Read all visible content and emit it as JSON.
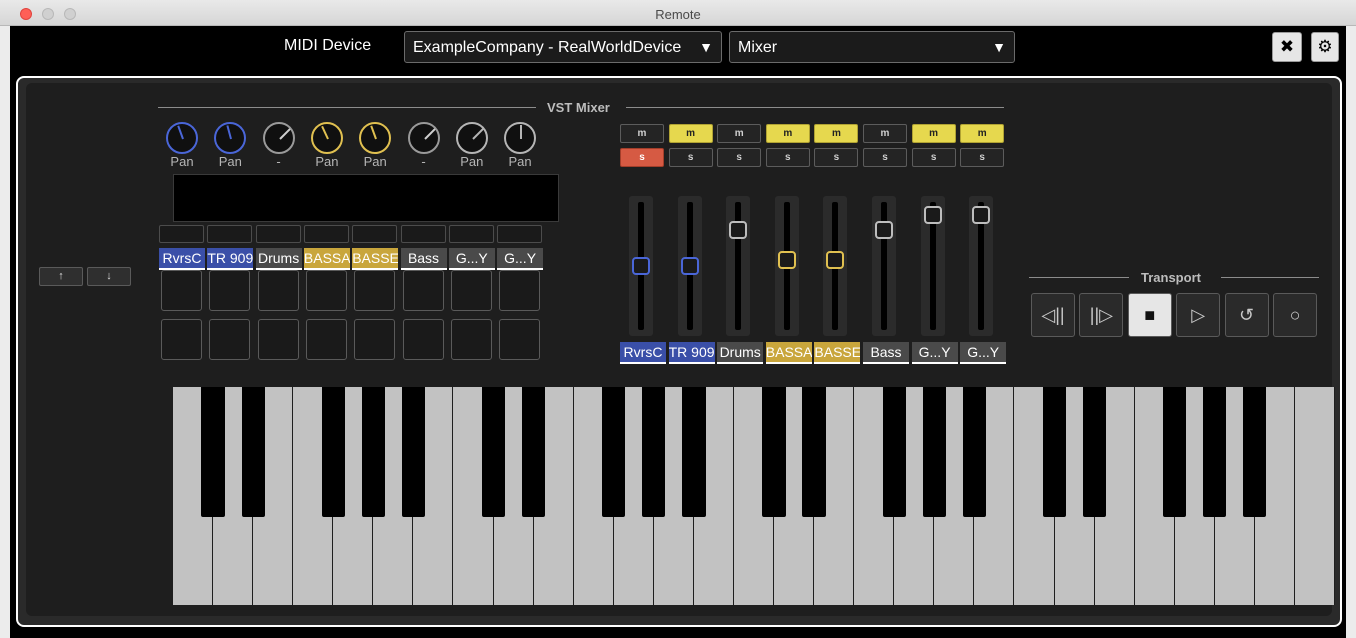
{
  "window": {
    "title": "Remote"
  },
  "topbar": {
    "midi_label": "MIDI Device",
    "device_value": "ExampleCompany - RealWorldDevice",
    "mode_value": "Mixer",
    "dropdown_arrow": "▼",
    "tools_icon": "✖",
    "settings_icon": "⚙"
  },
  "nav": {
    "up": "↑",
    "down": "↓"
  },
  "vst_mixer": {
    "title": "VST Mixer",
    "knobs": [
      {
        "label": "Pan",
        "color": "#4a66d8"
      },
      {
        "label": "Pan",
        "color": "#4a66d8"
      },
      {
        "label": "-",
        "color": "#9a9a9a"
      },
      {
        "label": "Pan",
        "color": "#e0c050"
      },
      {
        "label": "Pan",
        "color": "#e0c050"
      },
      {
        "label": "-",
        "color": "#9a9a9a"
      },
      {
        "label": "Pan",
        "color": "#b5b5b5"
      },
      {
        "label": "Pan",
        "color": "#b5b5b5"
      }
    ],
    "channels": [
      {
        "name": "RvrsC",
        "color": "#3a4fa8"
      },
      {
        "name": "TR 909",
        "color": "#3a4fa8"
      },
      {
        "name": "Drums",
        "color": "#4a4a4a"
      },
      {
        "name": "BASSA",
        "color": "#c9a63c"
      },
      {
        "name": "BASSE",
        "color": "#c9a63c"
      },
      {
        "name": "Bass",
        "color": "#4a4a4a"
      },
      {
        "name": "G...Y",
        "color": "#4a4a4a"
      },
      {
        "name": "G...Y",
        "color": "#4a4a4a"
      }
    ],
    "mute_label": "m",
    "solo_label": "s",
    "mute_states": [
      false,
      true,
      false,
      true,
      true,
      false,
      true,
      true
    ],
    "solo_states": [
      true,
      false,
      false,
      false,
      false,
      false,
      false,
      false
    ],
    "fader_levels": [
      0.5,
      0.5,
      0.78,
      0.55,
      0.55,
      0.78,
      0.9,
      0.9
    ],
    "fader_colors": [
      "#4a66d8",
      "#4a66d8",
      "#bdbdbd",
      "#e0c050",
      "#e0c050",
      "#bdbdbd",
      "#bdbdbd",
      "#bdbdbd"
    ]
  },
  "transport": {
    "title": "Transport",
    "buttons": [
      {
        "name": "rewind",
        "glyph": "◁||"
      },
      {
        "name": "forward",
        "glyph": "||▷"
      },
      {
        "name": "stop",
        "glyph": "■"
      },
      {
        "name": "play",
        "glyph": "▷"
      },
      {
        "name": "cycle",
        "glyph": "↺"
      },
      {
        "name": "record",
        "glyph": "○"
      }
    ],
    "active": "stop"
  },
  "keyboard": {
    "white_keys": 29
  }
}
